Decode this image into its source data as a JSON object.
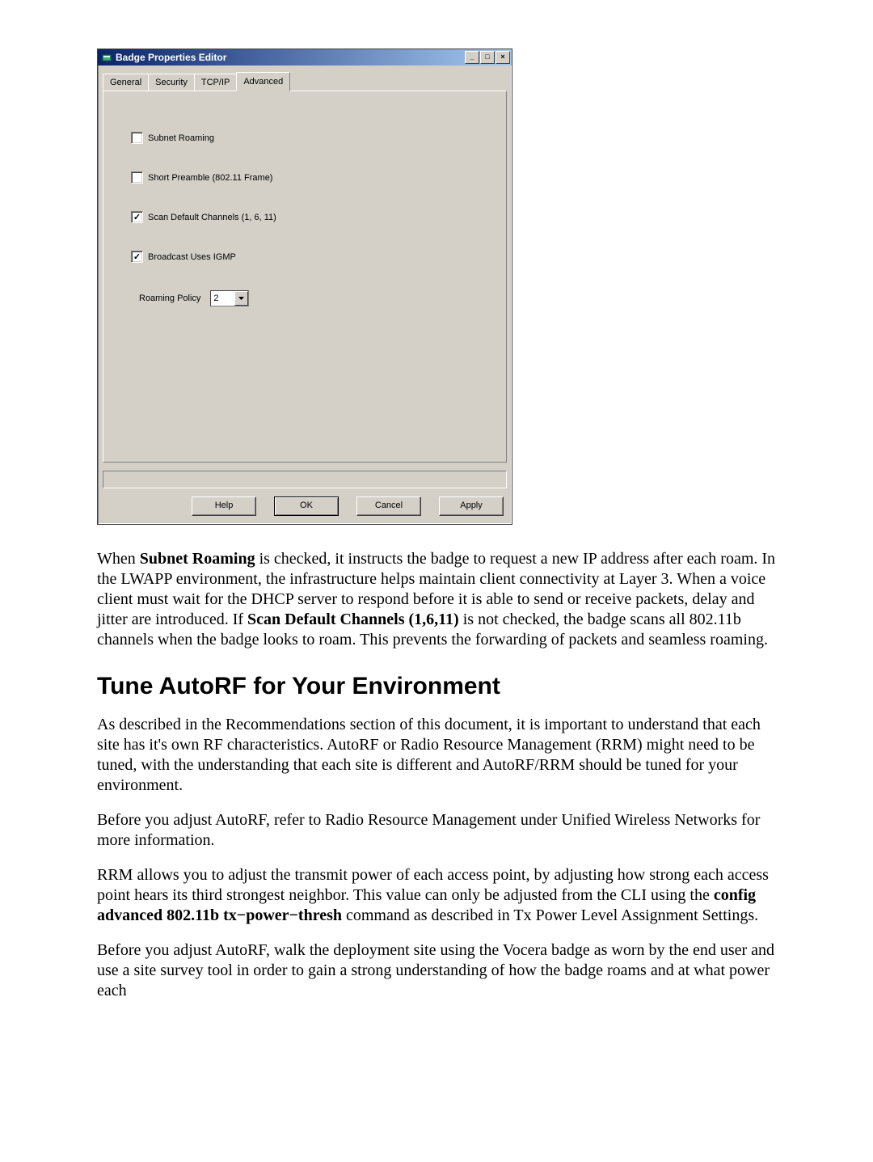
{
  "dialog": {
    "title": "Badge Properties Editor",
    "tabs": {
      "t0": "General",
      "t1": "Security",
      "t2": "TCP/IP",
      "t3": "Advanced"
    },
    "advanced": {
      "subnet_roaming": "Subnet Roaming",
      "short_preamble": "Short Preamble (802.11 Frame)",
      "scan_default": "Scan Default Channels (1, 6, 11)",
      "broadcast_igmp": "Broadcast Uses IGMP",
      "roaming_policy_label": "Roaming Policy",
      "roaming_policy_value": "2"
    },
    "buttons": {
      "help": "Help",
      "ok": "OK",
      "cancel": "Cancel",
      "apply": "Apply"
    },
    "checkmark": "✓",
    "win_min": "_",
    "win_max": "□",
    "win_close": "×"
  },
  "paragraphs": {
    "p1a": "When ",
    "p1b": "Subnet Roaming",
    "p1c": " is checked, it instructs the badge to request a new IP address after each roam. In the LWAPP environment, the infrastructure helps maintain client connectivity at Layer 3. When a voice client must wait for the DHCP server to respond before it is able to send or receive packets, delay and jitter are introduced. If ",
    "p1d": "Scan Default Channels (1,6,11)",
    "p1e": " is not checked, the badge scans all 802.11b channels when the badge looks to roam. This prevents the forwarding of packets and seamless roaming.",
    "h2": "Tune AutoRF for Your Environment",
    "p2": "As described in the Recommendations section of this document, it is important to understand that each site has it's own RF characteristics. AutoRF or Radio Resource Management (RRM) might need to be tuned, with the understanding that each site is different and AutoRF/RRM should be tuned for your environment.",
    "p3": "Before you adjust AutoRF, refer to Radio Resource Management under Unified Wireless Networks for more information.",
    "p4a": "RRM allows you to adjust the transmit power of each access point, by adjusting how strong each access point hears its third strongest neighbor. This value can only be adjusted from the CLI using the ",
    "p4b": "config advanced 802.11b tx−power−thresh",
    "p4c": " command as described in Tx Power Level Assignment Settings.",
    "p5": "Before you adjust AutoRF, walk the deployment site using the Vocera badge as worn by the end user and use a site survey tool in order to gain a strong understanding of how the badge roams and at what power each"
  }
}
